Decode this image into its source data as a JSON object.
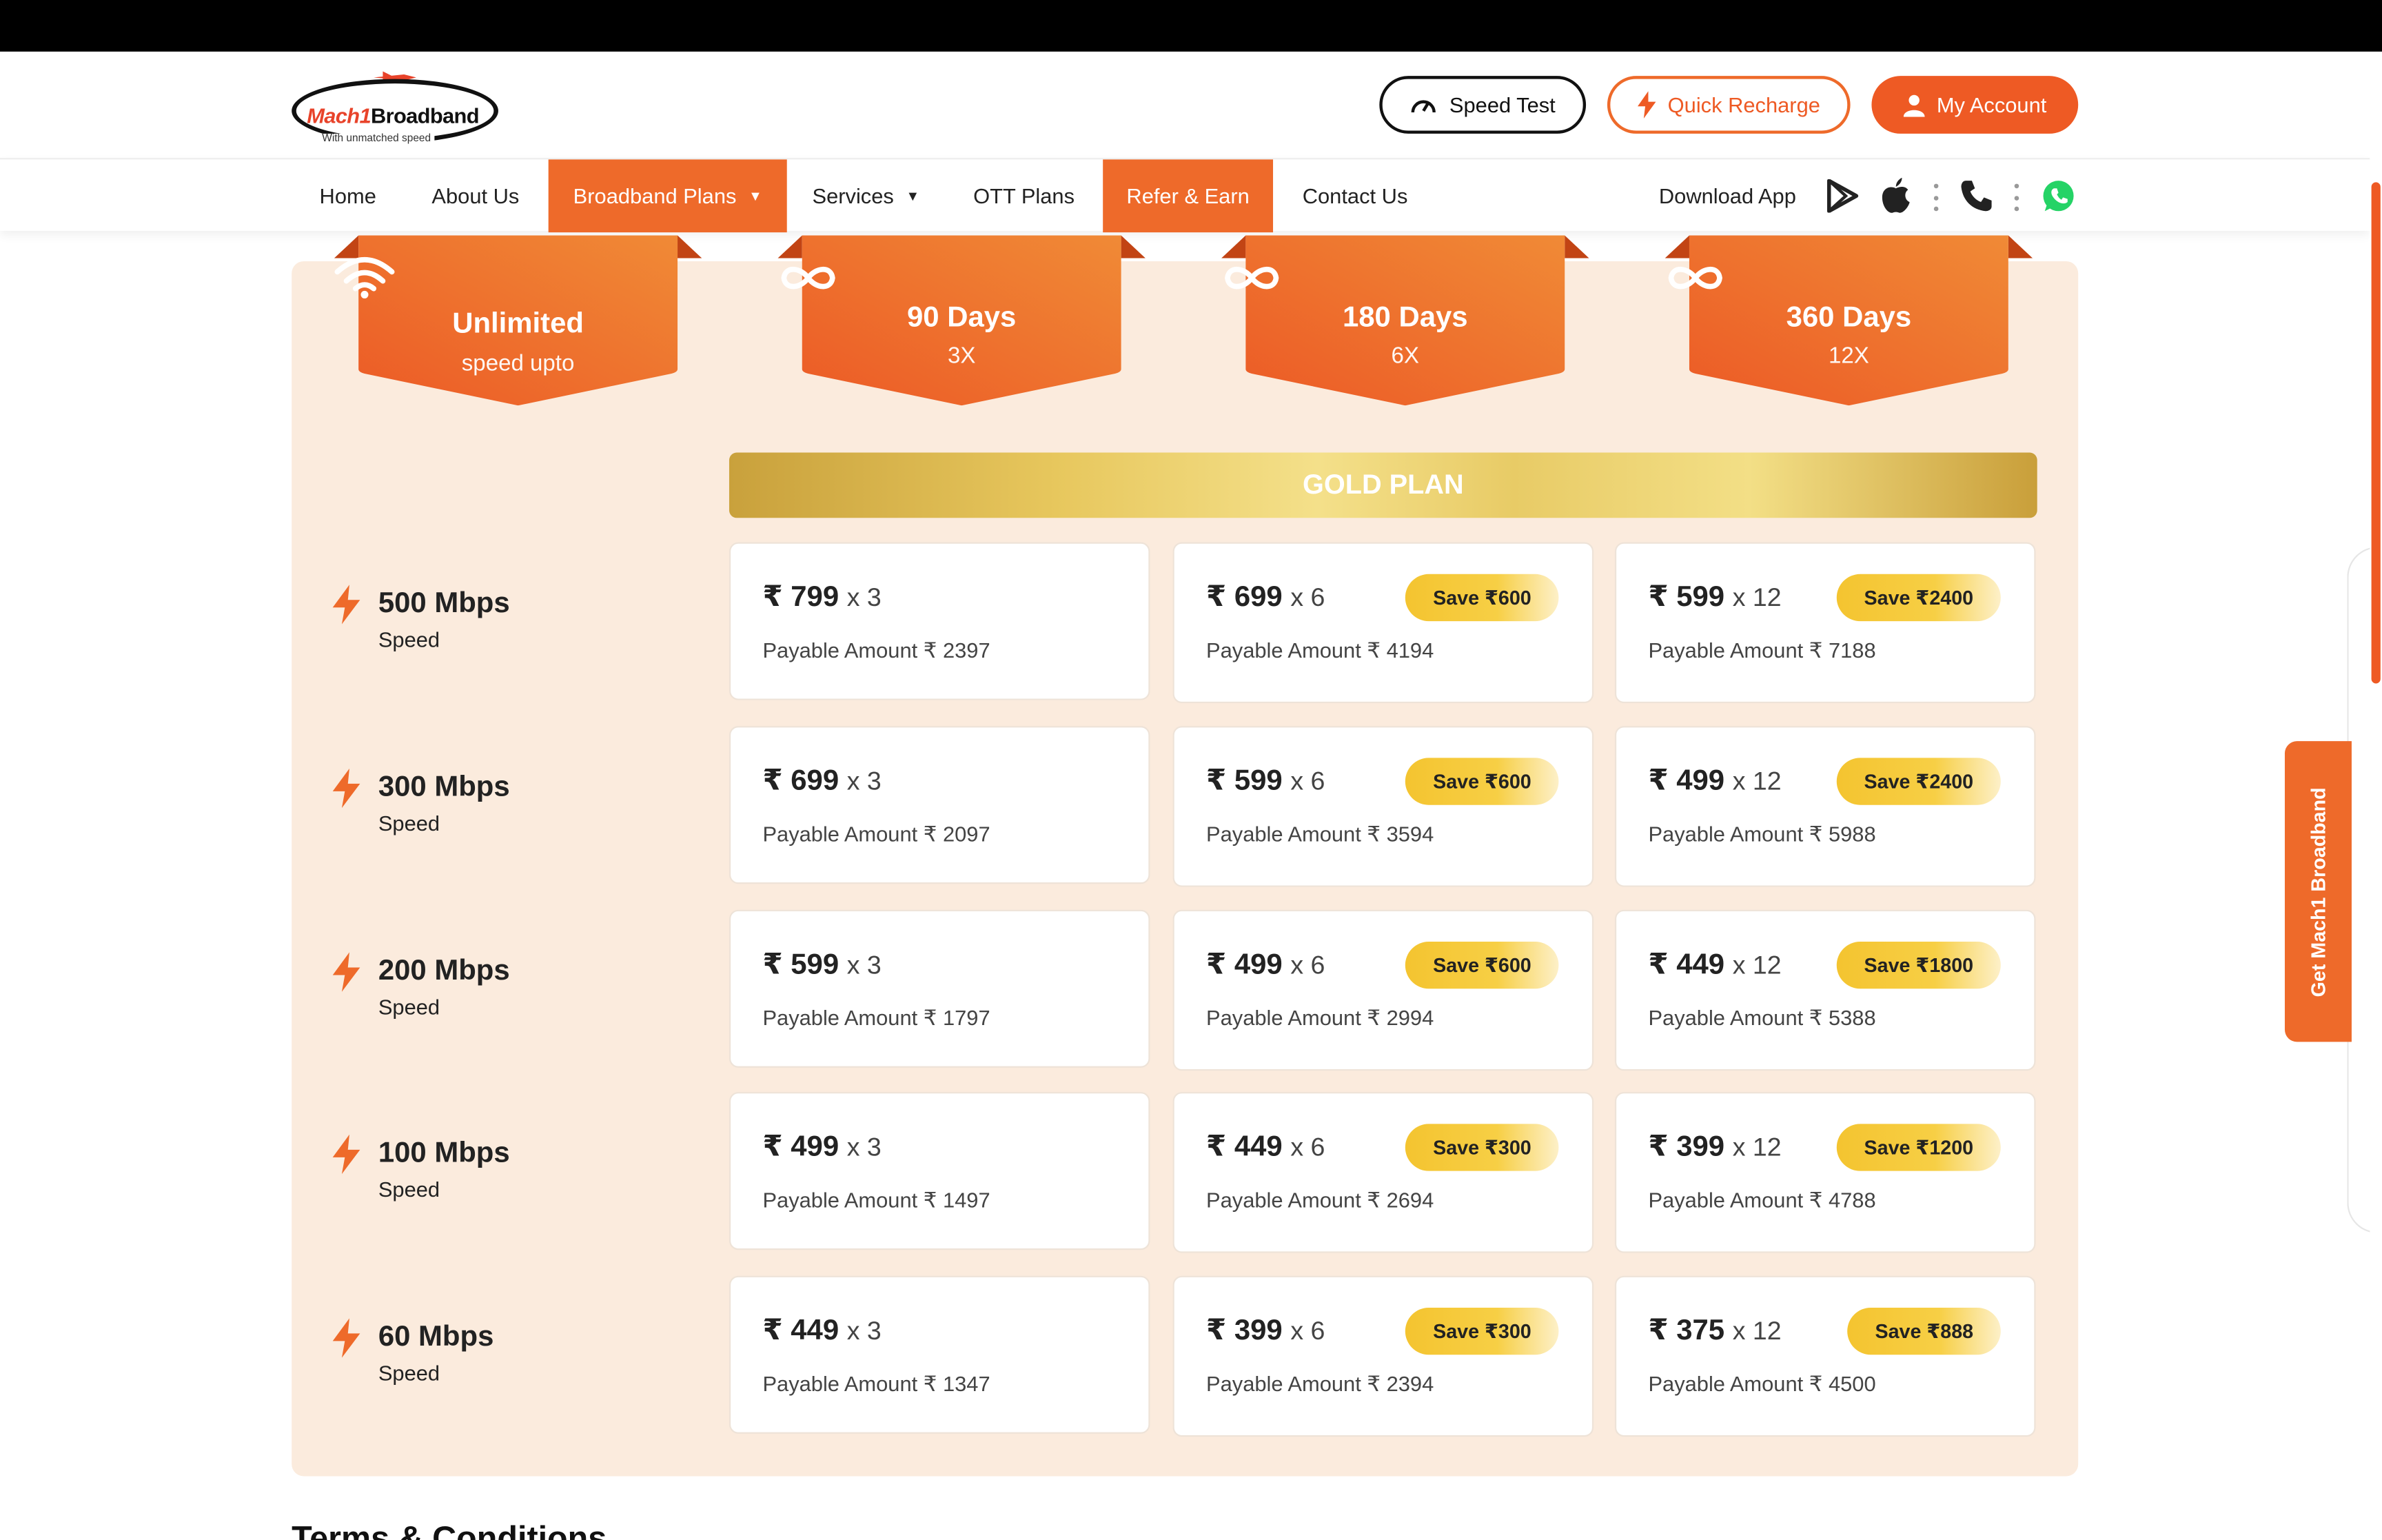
{
  "brand": {
    "logo_main_1": "Mach",
    "logo_main_2": "1",
    "logo_main_3": "Broadband",
    "logo_tagline": "With unmatched speed"
  },
  "header": {
    "speed_test": "Speed Test",
    "quick_recharge": "Quick Recharge",
    "my_account": "My Account"
  },
  "nav": {
    "items": [
      "Home",
      "About Us",
      "Broadband Plans",
      "Services",
      "OTT Plans",
      "Refer & Earn",
      "Contact Us"
    ],
    "download_app": "Download App"
  },
  "side_tab": "Get Mach1 Broadband",
  "colors": {
    "accent": "#ee6a2a",
    "panel": "#fbebdd",
    "gold": "#e7c75d",
    "save_badge": "#f4c430"
  },
  "ribbons": [
    {
      "title": "Unlimited",
      "sub": "speed upto",
      "icon": "wifi-icon"
    },
    {
      "title": "90 Days",
      "sub": "3X",
      "icon": "infinity-icon"
    },
    {
      "title": "180 Days",
      "sub": "6X",
      "icon": "infinity-icon"
    },
    {
      "title": "360 Days",
      "sub": "12X",
      "icon": "infinity-icon"
    }
  ],
  "plan_title": "GOLD PLAN",
  "speed_label": "Speed",
  "payable_prefix": "Payable Amount ₹",
  "rows": [
    {
      "speed": "500 Mbps",
      "plans": [
        {
          "price": "799",
          "mult": "x 3",
          "payable": "2397",
          "save": ""
        },
        {
          "price": "699",
          "mult": "x 6",
          "payable": "4194",
          "save": "Save ₹600"
        },
        {
          "price": "599",
          "mult": "x 12",
          "payable": "7188",
          "save": "Save ₹2400"
        }
      ]
    },
    {
      "speed": "300 Mbps",
      "plans": [
        {
          "price": "699",
          "mult": "x 3",
          "payable": "2097",
          "save": ""
        },
        {
          "price": "599",
          "mult": "x 6",
          "payable": "3594",
          "save": "Save ₹600"
        },
        {
          "price": "499",
          "mult": "x 12",
          "payable": "5988",
          "save": "Save ₹2400"
        }
      ]
    },
    {
      "speed": "200 Mbps",
      "plans": [
        {
          "price": "599",
          "mult": "x 3",
          "payable": "1797",
          "save": ""
        },
        {
          "price": "499",
          "mult": "x 6",
          "payable": "2994",
          "save": "Save ₹600"
        },
        {
          "price": "449",
          "mult": "x 12",
          "payable": "5388",
          "save": "Save ₹1800"
        }
      ]
    },
    {
      "speed": "100 Mbps",
      "plans": [
        {
          "price": "499",
          "mult": "x 3",
          "payable": "1497",
          "save": ""
        },
        {
          "price": "449",
          "mult": "x 6",
          "payable": "2694",
          "save": "Save ₹300"
        },
        {
          "price": "399",
          "mult": "x 12",
          "payable": "4788",
          "save": "Save ₹1200"
        }
      ]
    },
    {
      "speed": "60 Mbps",
      "plans": [
        {
          "price": "449",
          "mult": "x 3",
          "payable": "1347",
          "save": ""
        },
        {
          "price": "399",
          "mult": "x 6",
          "payable": "2394",
          "save": "Save ₹300"
        },
        {
          "price": "375",
          "mult": "x 12",
          "payable": "4500",
          "save": "Save ₹888"
        }
      ]
    }
  ],
  "terms_heading": "Terms & Conditions"
}
